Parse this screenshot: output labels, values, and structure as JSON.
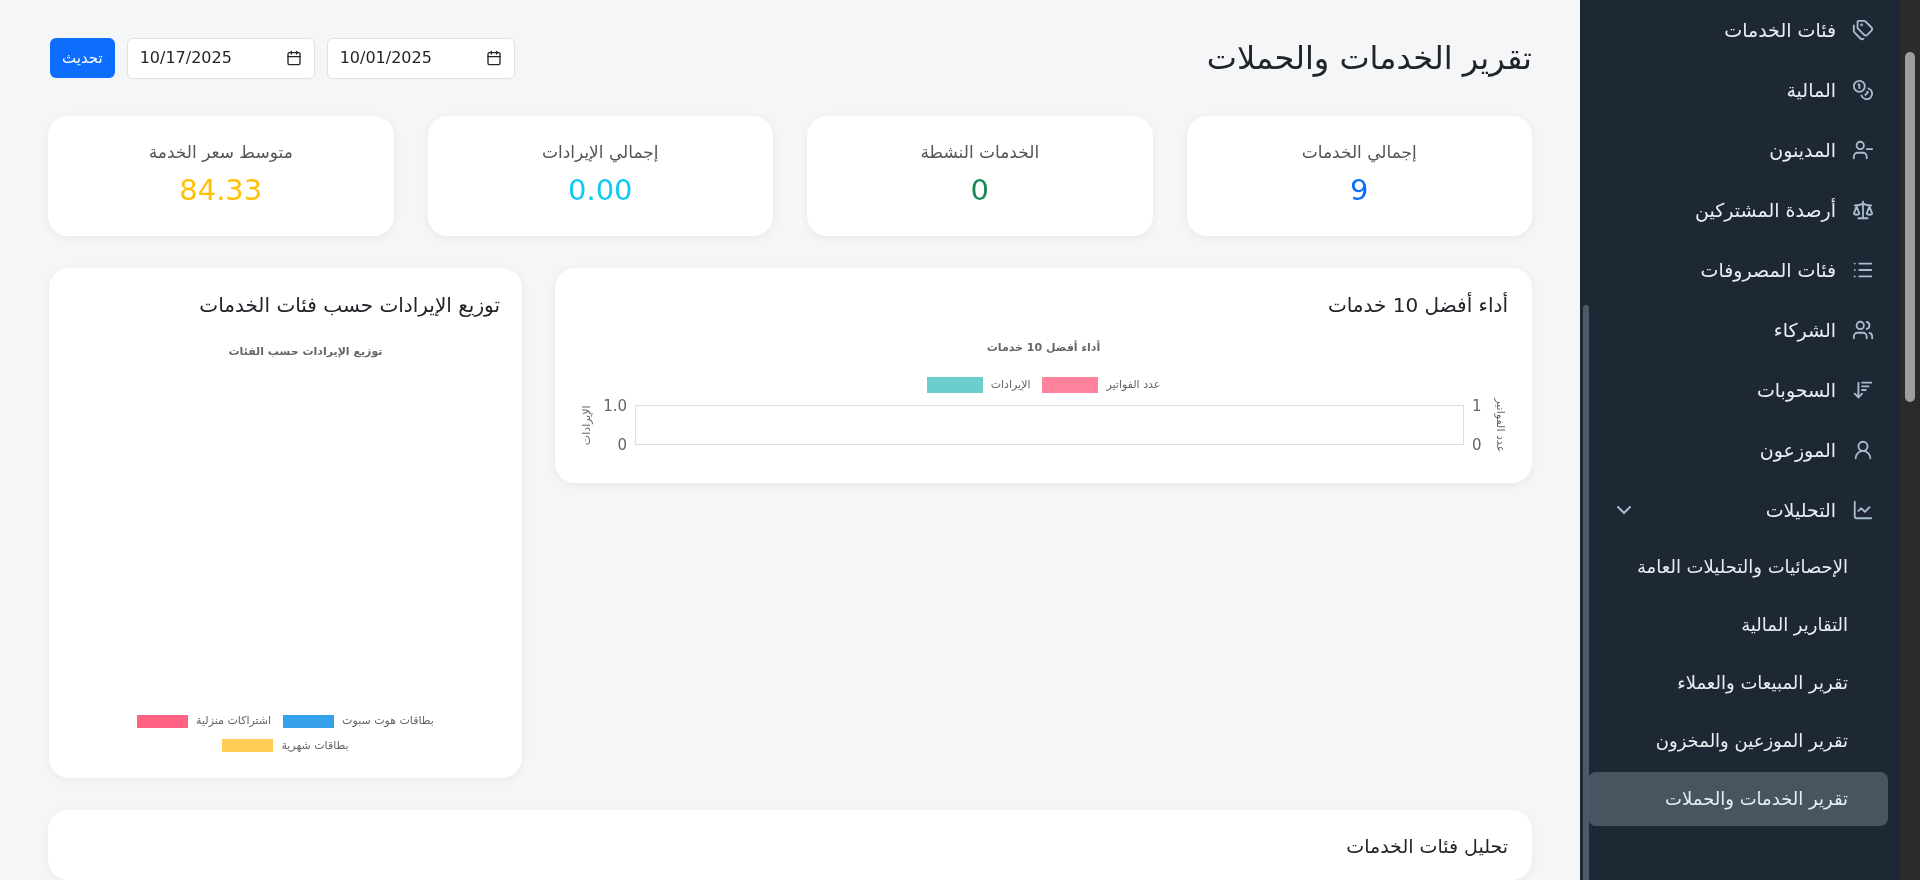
{
  "page": {
    "title": "تقرير الخدمات والحملات",
    "refresh_button": "تحديث",
    "date_from": "10/01/2025",
    "date_to": "10/17/2025"
  },
  "stats": [
    {
      "label": "إجمالي الخدمات",
      "value": "9",
      "color": "#0d6efd"
    },
    {
      "label": "الخدمات النشطة",
      "value": "0",
      "color": "#198754"
    },
    {
      "label": "إجمالي الإيرادات",
      "value": "0.00",
      "color": "#0dcaf0"
    },
    {
      "label": "متوسط سعر الخدمة",
      "value": "84.33",
      "color": "#ffc107"
    }
  ],
  "top_services": {
    "heading": "أداء أفضل 10 خدمات",
    "chart_title": "أداء أفضل 10 خدمات",
    "legend": [
      {
        "label": "عدد الفواتير",
        "color": "#ff829c"
      },
      {
        "label": "الإيرادات",
        "color": "#6ccdcd"
      }
    ],
    "left_axis": {
      "label": "الإيرادات",
      "ticks": [
        "1.0",
        "0"
      ]
    },
    "right_axis": {
      "label": "عدد الفواتير",
      "ticks": [
        "1",
        "0"
      ]
    }
  },
  "revenue_distribution": {
    "heading": "توزيع الإيرادات حسب فئات الخدمات",
    "chart_title": "توزيع الإيرادات حسب الفئات",
    "legend": [
      {
        "label": "بطاقات هوت سبوت",
        "color": "#36a2eb"
      },
      {
        "label": "اشتراكات منزلية",
        "color": "#ff6384"
      },
      {
        "label": "بطاقات شهرية",
        "color": "#ffcd56"
      }
    ]
  },
  "category_analysis": {
    "heading": "تحليل فئات الخدمات"
  },
  "sidebar": {
    "items": [
      {
        "label": "فئات الخدمات"
      },
      {
        "label": "المالية"
      },
      {
        "label": "المدينون"
      },
      {
        "label": "أرصدة المشتركين"
      },
      {
        "label": "فئات المصروفات"
      },
      {
        "label": "الشركاء"
      },
      {
        "label": "السحوبات"
      },
      {
        "label": "الموزعون"
      },
      {
        "label": "التحليلات",
        "expanded": true,
        "children": [
          {
            "label": "الإحصائيات والتحليلات العامة",
            "selected": false
          },
          {
            "label": "التقارير المالية",
            "selected": false
          },
          {
            "label": "تقرير المبيعات والعملاء",
            "selected": false
          },
          {
            "label": "تقرير الموزعين والمخزون",
            "selected": false
          },
          {
            "label": "تقرير الخدمات والحملات",
            "selected": true
          }
        ]
      }
    ]
  }
}
